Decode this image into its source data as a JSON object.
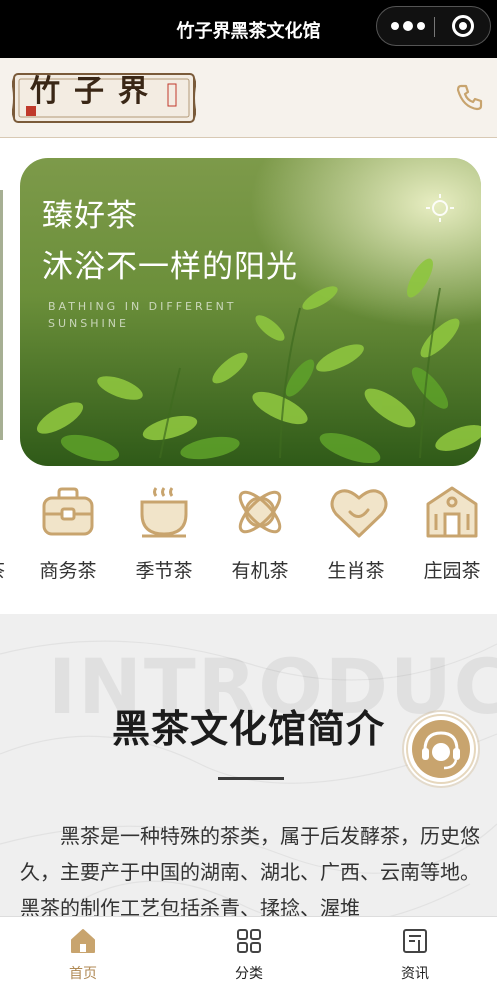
{
  "app": {
    "title": "竹子界黑茶文化馆"
  },
  "header": {
    "logo_text": "竹子界",
    "phone_icon": "phone-icon"
  },
  "banner": {
    "title_line1": "臻好茶",
    "title_line2": "沐浴不一样的阳光",
    "subtitle_line1": "BATHING IN DIFFERENT",
    "subtitle_line2": "SUNSHINE"
  },
  "categories": [
    {
      "label": "商务茶",
      "icon": "briefcase-icon"
    },
    {
      "label": "季节茶",
      "icon": "tea-cup-icon"
    },
    {
      "label": "有机茶",
      "icon": "orbit-icon"
    },
    {
      "label": "生肖茶",
      "icon": "heart-icon"
    },
    {
      "label": "庄园茶",
      "icon": "manor-icon"
    }
  ],
  "intro": {
    "bg_text": "INTRODUCE",
    "title": "黑茶文化馆简介",
    "body": "黑茶是一种特殊的茶类，属于后发酵茶，历史悠久，主要产于中国的湖南、湖北、广西、云南等地。黑茶的制作工艺包括杀青、揉捻、渥堆"
  },
  "tabs": [
    {
      "label": "首页",
      "icon": "home-icon"
    },
    {
      "label": "分类",
      "icon": "grid-icon"
    },
    {
      "label": "资讯",
      "icon": "news-icon"
    }
  ],
  "colors": {
    "accent": "#c8a46e",
    "active_tab": "#b08a55"
  }
}
